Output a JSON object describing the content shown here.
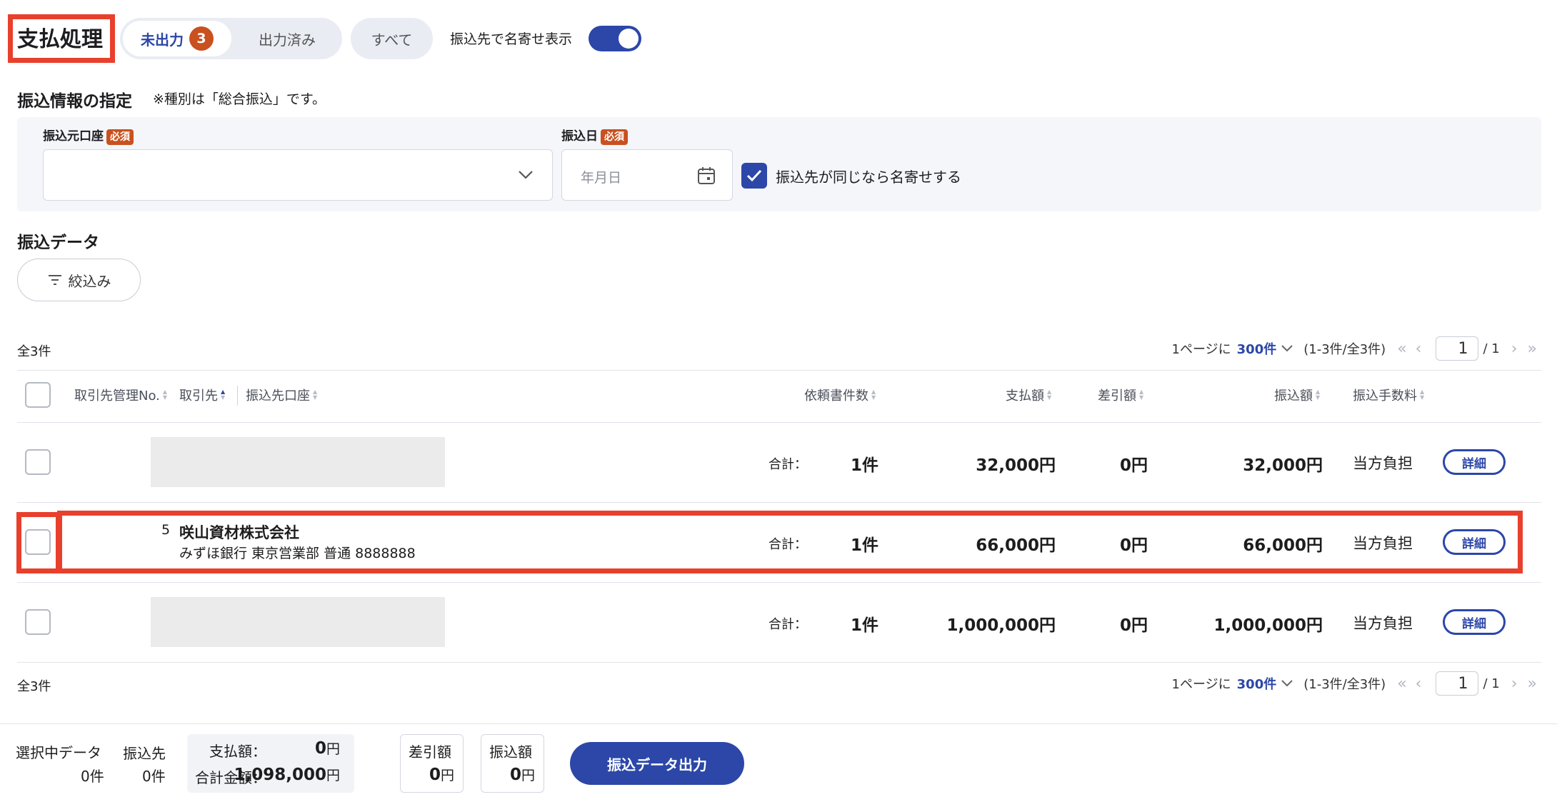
{
  "header": {
    "title": "支払処理",
    "tabs": [
      {
        "label": "未出力",
        "count": "3"
      },
      {
        "label": "出力済み"
      }
    ],
    "all_label": "すべて",
    "toggle_label": "振込先で名寄せ表示"
  },
  "transfer_info": {
    "heading": "振込情報の指定",
    "note": "※種別は「総合振込」です。",
    "source_account_label": "振込元口座",
    "source_account_value": "",
    "required": "必須",
    "date_label": "振込日",
    "date_placeholder": "年月日",
    "merge_checkbox_label": "振込先が同じなら名寄せする"
  },
  "transfer_data": {
    "heading": "振込データ",
    "filter_label": "絞込み",
    "total_label": "全3件",
    "pager": {
      "per_page_prefix": "1ページに",
      "per_page_value": "300件",
      "range": "(1-3件/全3件)",
      "page": "1",
      "pages": "/ 1"
    },
    "columns": {
      "partner_no": "取引先管理No.",
      "partner": "取引先",
      "account": "振込先口座",
      "request_count": "依頼書件数",
      "payment": "支払額",
      "deduction": "差引額",
      "transfer": "振込額",
      "fee": "振込手数料"
    },
    "rows": [
      {
        "no": "",
        "name": "",
        "bank": "",
        "sum_label": "合計：",
        "count": "1件",
        "payment": "32,000円",
        "deduction": "0円",
        "transfer": "32,000円",
        "fee": "当方負担",
        "detail": "詳細"
      },
      {
        "no": "5",
        "name": "咲山資材株式会社",
        "bank": "みずほ銀行 東京営業部 普通 8888888",
        "sum_label": "合計：",
        "count": "1件",
        "payment": "66,000円",
        "deduction": "0円",
        "transfer": "66,000円",
        "fee": "当方負担",
        "detail": "詳細"
      },
      {
        "no": "",
        "name": "",
        "bank": "",
        "sum_label": "合計：",
        "count": "1件",
        "payment": "1,000,000円",
        "deduction": "0円",
        "transfer": "1,000,000円",
        "fee": "当方負担",
        "detail": "詳細"
      }
    ]
  },
  "footer": {
    "selected_label": "選択中データ",
    "selected_value": "0件",
    "payee_label": "振込先",
    "payee_value": "0件",
    "payment_label": "支払額：",
    "payment_value": "0",
    "total_label": "合計金額：",
    "total_value": "1,098,000",
    "yen": "円",
    "deduction_label": "差引額",
    "deduction_value": "0",
    "transfer_label": "振込額",
    "transfer_value": "0",
    "export_button": "振込データ出力"
  },
  "colors": {
    "accent": "#2c47a8",
    "highlight": "#e8402c",
    "badge": "#c9511f"
  }
}
